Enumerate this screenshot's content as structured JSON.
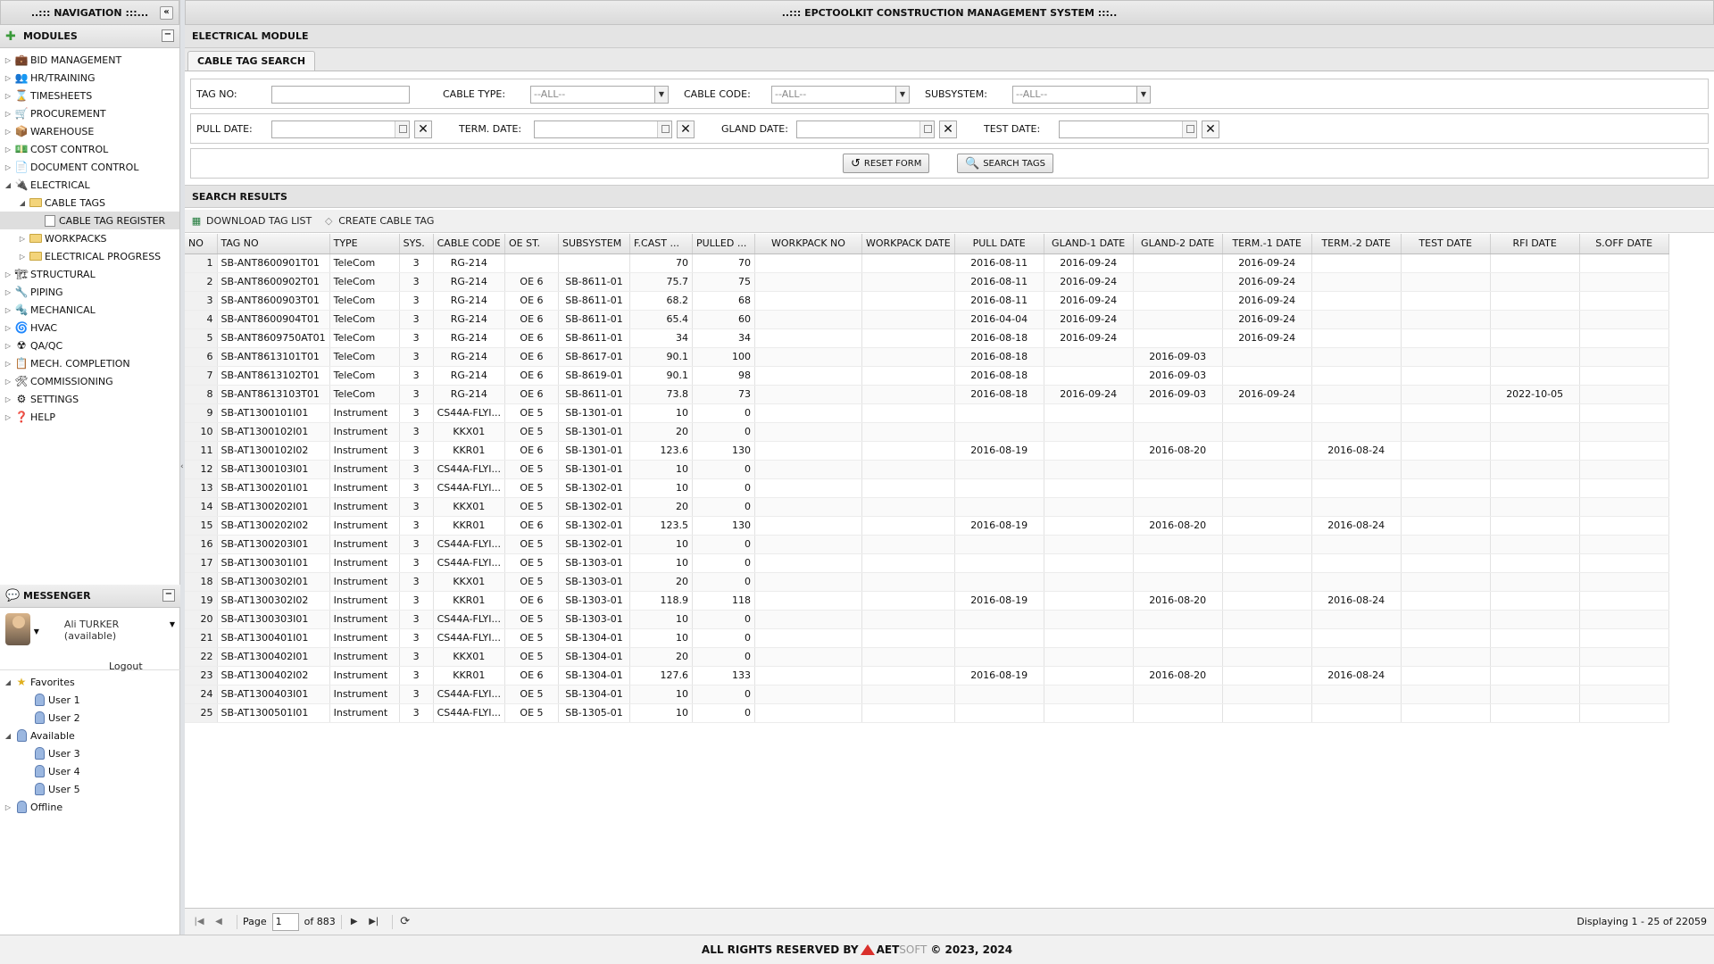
{
  "nav": {
    "title": "..::: NAVIGATION :::...",
    "modules_title": "MODULES",
    "items": [
      {
        "label": "BID MANAGEMENT",
        "icon": "briefcase-icon",
        "glyph": "💼"
      },
      {
        "label": "HR/TRAINING",
        "icon": "people-icon",
        "glyph": "👥"
      },
      {
        "label": "TIMESHEETS",
        "icon": "hourglass-icon",
        "glyph": "⌛"
      },
      {
        "label": "PROCUREMENT",
        "icon": "cart-icon",
        "glyph": "🛒"
      },
      {
        "label": "WAREHOUSE",
        "icon": "boxes-icon",
        "glyph": "📦"
      },
      {
        "label": "COST CONTROL",
        "icon": "money-icon",
        "glyph": "💵"
      },
      {
        "label": "DOCUMENT CONTROL",
        "icon": "document-icon",
        "glyph": "📄"
      },
      {
        "label": "ELECTRICAL",
        "icon": "plug-icon",
        "glyph": "🔌"
      },
      {
        "label": "CABLE TAGS",
        "icon": "folder-icon"
      },
      {
        "label": "CABLE TAG REGISTER",
        "icon": "page-icon"
      },
      {
        "label": "WORKPACKS",
        "icon": "folder-icon"
      },
      {
        "label": "ELECTRICAL PROGRESS",
        "icon": "folder-icon"
      },
      {
        "label": "STRUCTURAL",
        "icon": "crane-icon",
        "glyph": "🏗"
      },
      {
        "label": "PIPING",
        "icon": "pipe-icon",
        "glyph": "🔧"
      },
      {
        "label": "MECHANICAL",
        "icon": "wrench-icon",
        "glyph": "🔩"
      },
      {
        "label": "HVAC",
        "icon": "fan-icon",
        "glyph": "🌀"
      },
      {
        "label": "QA/QC",
        "icon": "radiation-icon",
        "glyph": "☢"
      },
      {
        "label": "MECH. COMPLETION",
        "icon": "checklist-icon",
        "glyph": "📋"
      },
      {
        "label": "COMMISSIONING",
        "icon": "tools-icon",
        "glyph": "🛠"
      },
      {
        "label": "SETTINGS",
        "icon": "settings-icon",
        "glyph": "⚙"
      },
      {
        "label": "HELP",
        "icon": "help-icon",
        "glyph": "❓"
      }
    ]
  },
  "messenger": {
    "title": "MESSENGER",
    "user": "Ali TURKER (available)",
    "logout": "Logout",
    "tree": [
      {
        "label": "Favorites",
        "level": 0
      },
      {
        "label": "User 1",
        "level": 1
      },
      {
        "label": "User 2",
        "level": 1
      },
      {
        "label": "Available",
        "level": 0
      },
      {
        "label": "User 3",
        "level": 1
      },
      {
        "label": "User 4",
        "level": 1
      },
      {
        "label": "User 5",
        "level": 1
      },
      {
        "label": "Offline",
        "level": 0
      }
    ]
  },
  "main": {
    "title": "..::: EPCTOOLKIT CONSTRUCTION MANAGEMENT SYSTEM :::..",
    "module": "ELECTRICAL MODULE",
    "tab": "CABLE TAG SEARCH"
  },
  "form": {
    "tag_no_label": "TAG NO:",
    "cable_type_label": "CABLE TYPE:",
    "cable_type_value": "--ALL--",
    "cable_code_label": "CABLE CODE:",
    "cable_code_value": "--ALL--",
    "subsystem_label": "SUBSYSTEM:",
    "subsystem_value": "--ALL--",
    "pull_date_label": "PULL DATE:",
    "term_date_label": "TERM. DATE:",
    "gland_date_label": "GLAND DATE:",
    "test_date_label": "TEST DATE:",
    "reset_label": "RESET FORM",
    "search_label": "SEARCH TAGS"
  },
  "results": {
    "title": "SEARCH RESULTS",
    "download_label": "DOWNLOAD TAG LIST",
    "create_label": "CREATE CABLE TAG",
    "columns": [
      "NO",
      "TAG NO",
      "TYPE",
      "SYS.",
      "CABLE CODE",
      "OE ST.",
      "SUBSYSTEM",
      "F.CAST ...",
      "PULLED ...",
      "WORKPACK NO",
      "WORKPACK DATE",
      "PULL DATE",
      "GLAND-1 DATE",
      "GLAND-2 DATE",
      "TERM.-1 DATE",
      "TERM.-2 DATE",
      "TEST DATE",
      "RFI DATE",
      "S.OFF DATE"
    ],
    "rows": [
      [
        "1",
        "SB-ANT8600901T01",
        "TeleCom",
        "3",
        "RG-214",
        "",
        "",
        "70",
        "70",
        "",
        "",
        "2016-08-11",
        "2016-09-24",
        "",
        "2016-09-24",
        "",
        "",
        "",
        ""
      ],
      [
        "2",
        "SB-ANT8600902T01",
        "TeleCom",
        "3",
        "RG-214",
        "OE 6",
        "SB-8611-01",
        "75.7",
        "75",
        "",
        "",
        "2016-08-11",
        "2016-09-24",
        "",
        "2016-09-24",
        "",
        "",
        "",
        ""
      ],
      [
        "3",
        "SB-ANT8600903T01",
        "TeleCom",
        "3",
        "RG-214",
        "OE 6",
        "SB-8611-01",
        "68.2",
        "68",
        "",
        "",
        "2016-08-11",
        "2016-09-24",
        "",
        "2016-09-24",
        "",
        "",
        "",
        ""
      ],
      [
        "4",
        "SB-ANT8600904T01",
        "TeleCom",
        "3",
        "RG-214",
        "OE 6",
        "SB-8611-01",
        "65.4",
        "60",
        "",
        "",
        "2016-04-04",
        "2016-09-24",
        "",
        "2016-09-24",
        "",
        "",
        "",
        ""
      ],
      [
        "5",
        "SB-ANT8609750AT01",
        "TeleCom",
        "3",
        "RG-214",
        "OE 6",
        "SB-8611-01",
        "34",
        "34",
        "",
        "",
        "2016-08-18",
        "2016-09-24",
        "",
        "2016-09-24",
        "",
        "",
        "",
        ""
      ],
      [
        "6",
        "SB-ANT8613101T01",
        "TeleCom",
        "3",
        "RG-214",
        "OE 6",
        "SB-8617-01",
        "90.1",
        "100",
        "",
        "",
        "2016-08-18",
        "",
        "2016-09-03",
        "",
        "",
        "",
        "",
        ""
      ],
      [
        "7",
        "SB-ANT8613102T01",
        "TeleCom",
        "3",
        "RG-214",
        "OE 6",
        "SB-8619-01",
        "90.1",
        "98",
        "",
        "",
        "2016-08-18",
        "",
        "2016-09-03",
        "",
        "",
        "",
        "",
        ""
      ],
      [
        "8",
        "SB-ANT8613103T01",
        "TeleCom",
        "3",
        "RG-214",
        "OE 6",
        "SB-8611-01",
        "73.8",
        "73",
        "",
        "",
        "2016-08-18",
        "2016-09-24",
        "2016-09-03",
        "2016-09-24",
        "",
        "",
        "2022-10-05",
        ""
      ],
      [
        "9",
        "SB-AT1300101I01",
        "Instrument",
        "3",
        "CS44A-FLYI...",
        "OE 5",
        "SB-1301-01",
        "10",
        "0",
        "",
        "",
        "",
        "",
        "",
        "",
        "",
        "",
        "",
        ""
      ],
      [
        "10",
        "SB-AT1300102I01",
        "Instrument",
        "3",
        "KKX01",
        "OE 5",
        "SB-1301-01",
        "20",
        "0",
        "",
        "",
        "",
        "",
        "",
        "",
        "",
        "",
        "",
        ""
      ],
      [
        "11",
        "SB-AT1300102I02",
        "Instrument",
        "3",
        "KKR01",
        "OE 6",
        "SB-1301-01",
        "123.6",
        "130",
        "",
        "",
        "2016-08-19",
        "",
        "2016-08-20",
        "",
        "2016-08-24",
        "",
        "",
        ""
      ],
      [
        "12",
        "SB-AT1300103I01",
        "Instrument",
        "3",
        "CS44A-FLYI...",
        "OE 5",
        "SB-1301-01",
        "10",
        "0",
        "",
        "",
        "",
        "",
        "",
        "",
        "",
        "",
        "",
        ""
      ],
      [
        "13",
        "SB-AT1300201I01",
        "Instrument",
        "3",
        "CS44A-FLYI...",
        "OE 5",
        "SB-1302-01",
        "10",
        "0",
        "",
        "",
        "",
        "",
        "",
        "",
        "",
        "",
        "",
        ""
      ],
      [
        "14",
        "SB-AT1300202I01",
        "Instrument",
        "3",
        "KKX01",
        "OE 5",
        "SB-1302-01",
        "20",
        "0",
        "",
        "",
        "",
        "",
        "",
        "",
        "",
        "",
        "",
        ""
      ],
      [
        "15",
        "SB-AT1300202I02",
        "Instrument",
        "3",
        "KKR01",
        "OE 6",
        "SB-1302-01",
        "123.5",
        "130",
        "",
        "",
        "2016-08-19",
        "",
        "2016-08-20",
        "",
        "2016-08-24",
        "",
        "",
        ""
      ],
      [
        "16",
        "SB-AT1300203I01",
        "Instrument",
        "3",
        "CS44A-FLYI...",
        "OE 5",
        "SB-1302-01",
        "10",
        "0",
        "",
        "",
        "",
        "",
        "",
        "",
        "",
        "",
        "",
        ""
      ],
      [
        "17",
        "SB-AT1300301I01",
        "Instrument",
        "3",
        "CS44A-FLYI...",
        "OE 5",
        "SB-1303-01",
        "10",
        "0",
        "",
        "",
        "",
        "",
        "",
        "",
        "",
        "",
        "",
        ""
      ],
      [
        "18",
        "SB-AT1300302I01",
        "Instrument",
        "3",
        "KKX01",
        "OE 5",
        "SB-1303-01",
        "20",
        "0",
        "",
        "",
        "",
        "",
        "",
        "",
        "",
        "",
        "",
        ""
      ],
      [
        "19",
        "SB-AT1300302I02",
        "Instrument",
        "3",
        "KKR01",
        "OE 6",
        "SB-1303-01",
        "118.9",
        "118",
        "",
        "",
        "2016-08-19",
        "",
        "2016-08-20",
        "",
        "2016-08-24",
        "",
        "",
        ""
      ],
      [
        "20",
        "SB-AT1300303I01",
        "Instrument",
        "3",
        "CS44A-FLYI...",
        "OE 5",
        "SB-1303-01",
        "10",
        "0",
        "",
        "",
        "",
        "",
        "",
        "",
        "",
        "",
        "",
        ""
      ],
      [
        "21",
        "SB-AT1300401I01",
        "Instrument",
        "3",
        "CS44A-FLYI...",
        "OE 5",
        "SB-1304-01",
        "10",
        "0",
        "",
        "",
        "",
        "",
        "",
        "",
        "",
        "",
        "",
        ""
      ],
      [
        "22",
        "SB-AT1300402I01",
        "Instrument",
        "3",
        "KKX01",
        "OE 5",
        "SB-1304-01",
        "20",
        "0",
        "",
        "",
        "",
        "",
        "",
        "",
        "",
        "",
        "",
        ""
      ],
      [
        "23",
        "SB-AT1300402I02",
        "Instrument",
        "3",
        "KKR01",
        "OE 6",
        "SB-1304-01",
        "127.6",
        "133",
        "",
        "",
        "2016-08-19",
        "",
        "2016-08-20",
        "",
        "2016-08-24",
        "",
        "",
        ""
      ],
      [
        "24",
        "SB-AT1300403I01",
        "Instrument",
        "3",
        "CS44A-FLYI...",
        "OE 5",
        "SB-1304-01",
        "10",
        "0",
        "",
        "",
        "",
        "",
        "",
        "",
        "",
        "",
        "",
        ""
      ],
      [
        "25",
        "SB-AT1300501I01",
        "Instrument",
        "3",
        "CS44A-FLYI...",
        "OE 5",
        "SB-1305-01",
        "10",
        "0",
        "",
        "",
        "",
        "",
        "",
        "",
        "",
        "",
        "",
        ""
      ]
    ]
  },
  "pager": {
    "page_label": "Page",
    "page_value": "1",
    "of_label": "of 883",
    "displaying": "Displaying 1 - 25 of 22059"
  },
  "footer": {
    "text": "ALL RIGHTS RESERVED BY",
    "brand_a": "AET",
    "brand_b": "SOFT",
    "year": "© 2023, 2024"
  }
}
